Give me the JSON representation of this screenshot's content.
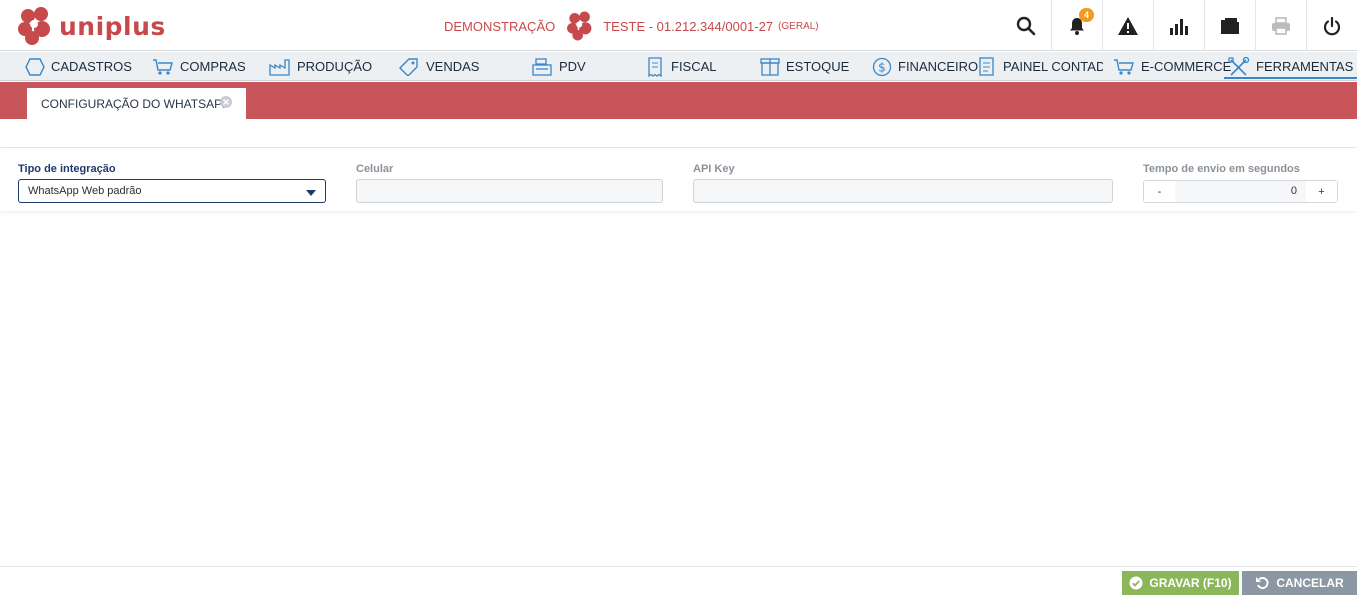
{
  "brand": {
    "name": "uniplus",
    "color": "#c8494b"
  },
  "company": {
    "mode": "DEMONSTRAÇÃO",
    "name": "TESTE - 01.212.344/0001-27",
    "scope": "(GERAL)"
  },
  "header_actions": [
    {
      "icon": "search-icon"
    },
    {
      "icon": "bell-icon",
      "badge": "4"
    },
    {
      "icon": "warning-icon"
    },
    {
      "icon": "bar-chart-icon"
    },
    {
      "icon": "folder-icon"
    },
    {
      "icon": "printer-icon"
    },
    {
      "icon": "power-icon"
    }
  ],
  "menu": {
    "items": [
      {
        "label": "CADASTROS",
        "icon": "hexagon-icon"
      },
      {
        "label": "COMPRAS",
        "icon": "cart-icon"
      },
      {
        "label": "PRODUÇÃO",
        "icon": "factory-icon"
      },
      {
        "label": "VENDAS",
        "icon": "tag-icon"
      },
      {
        "label": "PDV",
        "icon": "cash-register-icon"
      },
      {
        "label": "FISCAL",
        "icon": "receipt-icon"
      },
      {
        "label": "ESTOQUE",
        "icon": "box-icon"
      },
      {
        "label": "FINANCEIRO",
        "icon": "dollar-icon"
      },
      {
        "label": "PAINEL CONTADOR",
        "icon": "ledger-icon"
      },
      {
        "label": "E-COMMERCE",
        "icon": "cart-icon"
      },
      {
        "label": "FERRAMENTAS",
        "icon": "tools-icon",
        "active": true
      }
    ]
  },
  "tab": {
    "label": "CONFIGURAÇÃO DO WHATSAPP"
  },
  "form": {
    "integration_type": {
      "label": "Tipo de integração",
      "value": "WhatsApp Web padrão"
    },
    "phone": {
      "label": "Celular",
      "value": ""
    },
    "api_key": {
      "label": "API Key",
      "value": ""
    },
    "send_interval": {
      "label": "Tempo de envio em segundos",
      "value": "0",
      "decrement": "-",
      "increment": "+"
    }
  },
  "footer": {
    "save_label": "GRAVAR (F10)",
    "cancel_label": "CANCELAR"
  },
  "colors": {
    "tab_strip": "#c8555a",
    "save": "#8bb65a",
    "cancel": "#8b97a3",
    "menu_active": "#3a87c8"
  }
}
